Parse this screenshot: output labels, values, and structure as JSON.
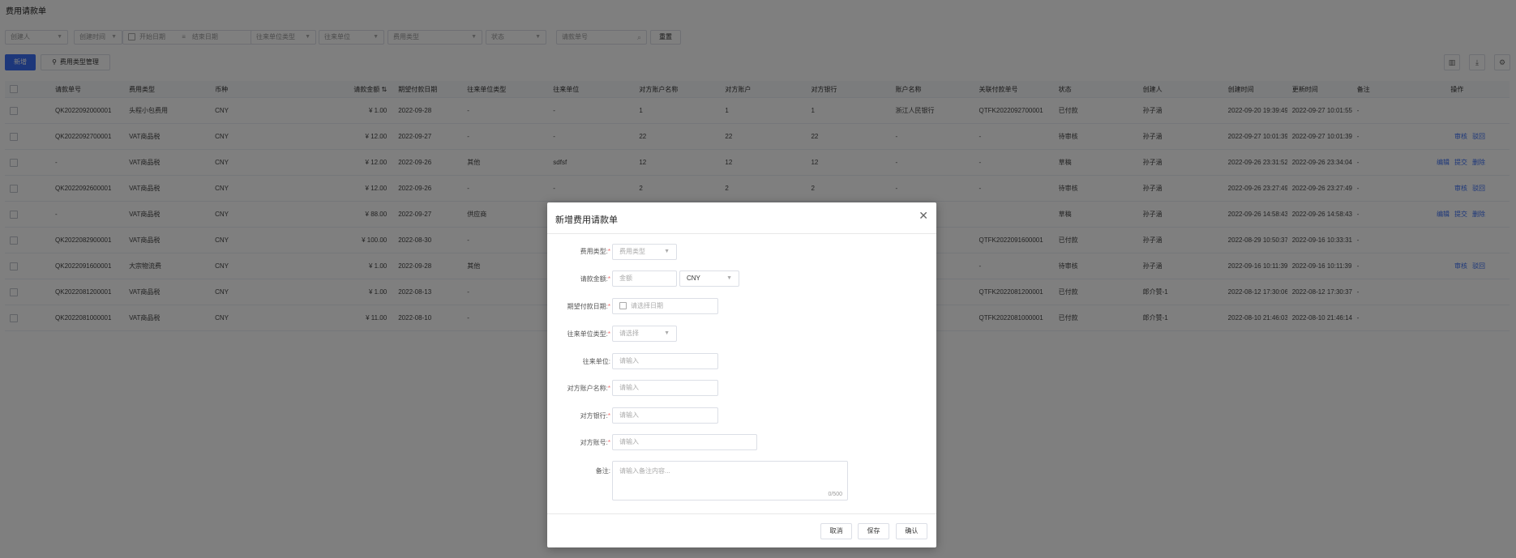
{
  "page": {
    "title": "费用请款单"
  },
  "filters": {
    "creator": "创建人",
    "created_time": "创建时间",
    "start_date": "开始日期",
    "end_date": "结束日期",
    "counterparty_type": "往来单位类型",
    "counterparty": "往来单位",
    "fee_type": "费用类型",
    "status": "状态",
    "request_no": "请款单号",
    "reset": "重置"
  },
  "toolbar": {
    "add": "新增",
    "fee_type_manage": "费用类型管理"
  },
  "table": {
    "columns": [
      "请款单号",
      "费用类型",
      "币种",
      "请款金额",
      "期望付款日期",
      "往来单位类型",
      "往来单位",
      "对方账户名称",
      "对方账户",
      "对方银行",
      "账户名称",
      "关联付款单号",
      "状态",
      "创建人",
      "创建时间",
      "更新时间",
      "备注",
      "操作"
    ],
    "rows": [
      {
        "no": "QK2022092000001",
        "fee_type": "头程小包费用",
        "currency": "CNY",
        "amount": "¥ 1.00",
        "pay_date": "2022-09-28",
        "cp_type": "-",
        "cp": "-",
        "acct_name": "1",
        "acct": "1",
        "bank": "1",
        "account_name": "浙江人民银行",
        "pay_no": "QTFK2022092700001",
        "status": "已付款",
        "creator": "孙子涵",
        "created": "2022-09-20 19:39:49",
        "updated": "2022-09-27 10:01:55",
        "remark": "-",
        "actions": []
      },
      {
        "no": "QK2022092700001",
        "fee_type": "VAT商品税",
        "currency": "CNY",
        "amount": "¥ 12.00",
        "pay_date": "2022-09-27",
        "cp_type": "-",
        "cp": "-",
        "acct_name": "22",
        "acct": "22",
        "bank": "22",
        "account_name": "-",
        "pay_no": "-",
        "status": "待审核",
        "creator": "孙子涵",
        "created": "2022-09-27 10:01:39",
        "updated": "2022-09-27 10:01:39",
        "remark": "-",
        "actions": [
          "审核",
          "驳回"
        ]
      },
      {
        "no": "-",
        "fee_type": "VAT商品税",
        "currency": "CNY",
        "amount": "¥ 12.00",
        "pay_date": "2022-09-26",
        "cp_type": "其他",
        "cp": "sdfsf",
        "acct_name": "12",
        "acct": "12",
        "bank": "12",
        "account_name": "-",
        "pay_no": "-",
        "status": "草稿",
        "creator": "孙子涵",
        "created": "2022-09-26 23:31:52",
        "updated": "2022-09-26 23:34:04",
        "remark": "-",
        "actions": [
          "编辑",
          "提交",
          "删除"
        ]
      },
      {
        "no": "QK2022092600001",
        "fee_type": "VAT商品税",
        "currency": "CNY",
        "amount": "¥ 12.00",
        "pay_date": "2022-09-26",
        "cp_type": "-",
        "cp": "-",
        "acct_name": "2",
        "acct": "2",
        "bank": "2",
        "account_name": "-",
        "pay_no": "-",
        "status": "待审核",
        "creator": "孙子涵",
        "created": "2022-09-26 23:27:49",
        "updated": "2022-09-26 23:27:49",
        "remark": "-",
        "actions": [
          "审核",
          "驳回"
        ]
      },
      {
        "no": "-",
        "fee_type": "VAT商品税",
        "currency": "CNY",
        "amount": "¥ 88.00",
        "pay_date": "2022-09-27",
        "cp_type": "供应商",
        "cp": "",
        "acct_name": "",
        "acct": "",
        "bank": "",
        "account_name": "",
        "pay_no": "",
        "status": "草稿",
        "creator": "孙子涵",
        "created": "2022-09-26 14:58:43",
        "updated": "2022-09-26 14:58:43",
        "remark": "-",
        "actions": [
          "编辑",
          "提交",
          "删除"
        ]
      },
      {
        "no": "QK2022082900001",
        "fee_type": "VAT商品税",
        "currency": "CNY",
        "amount": "¥ 100.00",
        "pay_date": "2022-08-30",
        "cp_type": "-",
        "cp": "",
        "acct_name": "",
        "acct": "",
        "bank": "",
        "account_name": "",
        "pay_no": "QTFK2022091600001",
        "status": "已付款",
        "creator": "孙子涵",
        "created": "2022-08-29 10:50:37",
        "updated": "2022-09-16 10:33:31",
        "remark": "-",
        "actions": []
      },
      {
        "no": "QK2022091600001",
        "fee_type": "大宗物流费",
        "currency": "CNY",
        "amount": "¥ 1.00",
        "pay_date": "2022-09-28",
        "cp_type": "其他",
        "cp": "",
        "acct_name": "",
        "acct": "",
        "bank": "",
        "account_name": "",
        "pay_no": "-",
        "status": "待审核",
        "creator": "孙子涵",
        "created": "2022-09-16 10:11:39",
        "updated": "2022-09-16 10:11:39",
        "remark": "-",
        "actions": [
          "审核",
          "驳回"
        ]
      },
      {
        "no": "QK2022081200001",
        "fee_type": "VAT商品税",
        "currency": "CNY",
        "amount": "¥ 1.00",
        "pay_date": "2022-08-13",
        "cp_type": "-",
        "cp": "",
        "acct_name": "",
        "acct": "",
        "bank": "",
        "account_name": "",
        "pay_no": "QTFK2022081200001",
        "status": "已付款",
        "creator": "郎介赞-1",
        "created": "2022-08-12 17:30:06",
        "updated": "2022-08-12 17:30:37",
        "remark": "-",
        "actions": []
      },
      {
        "no": "QK2022081000001",
        "fee_type": "VAT商品税",
        "currency": "CNY",
        "amount": "¥ 11.00",
        "pay_date": "2022-08-10",
        "cp_type": "-",
        "cp": "",
        "acct_name": "",
        "acct": "",
        "bank": "",
        "account_name": "",
        "pay_no": "QTFK2022081000001",
        "status": "已付款",
        "creator": "郎介赞-1",
        "created": "2022-08-10 21:46:03",
        "updated": "2022-08-10 21:46:14",
        "remark": "-",
        "actions": []
      }
    ]
  },
  "modal": {
    "title": "新增费用请款单",
    "fee_type_label": "费用类型:",
    "fee_type_placeholder": "费用类型",
    "amount_label": "请款金额:",
    "amount_placeholder": "金额",
    "currency_value": "CNY",
    "pay_date_label": "期望付款日期:",
    "pay_date_placeholder": "请选择日期",
    "cp_type_label": "往来单位类型:",
    "cp_type_placeholder": "请选择",
    "cp_label": "往来单位:",
    "cp_placeholder": "请输入",
    "acct_name_label": "对方账户名称:",
    "acct_name_placeholder": "请输入",
    "bank_label": "对方银行:",
    "bank_placeholder": "请输入",
    "acct_label": "对方账号:",
    "acct_placeholder": "请输入",
    "remark_label": "备注:",
    "remark_placeholder": "请输入备注内容...",
    "remark_counter": "0/500",
    "cancel": "取消",
    "save": "保存",
    "confirm": "确认"
  }
}
